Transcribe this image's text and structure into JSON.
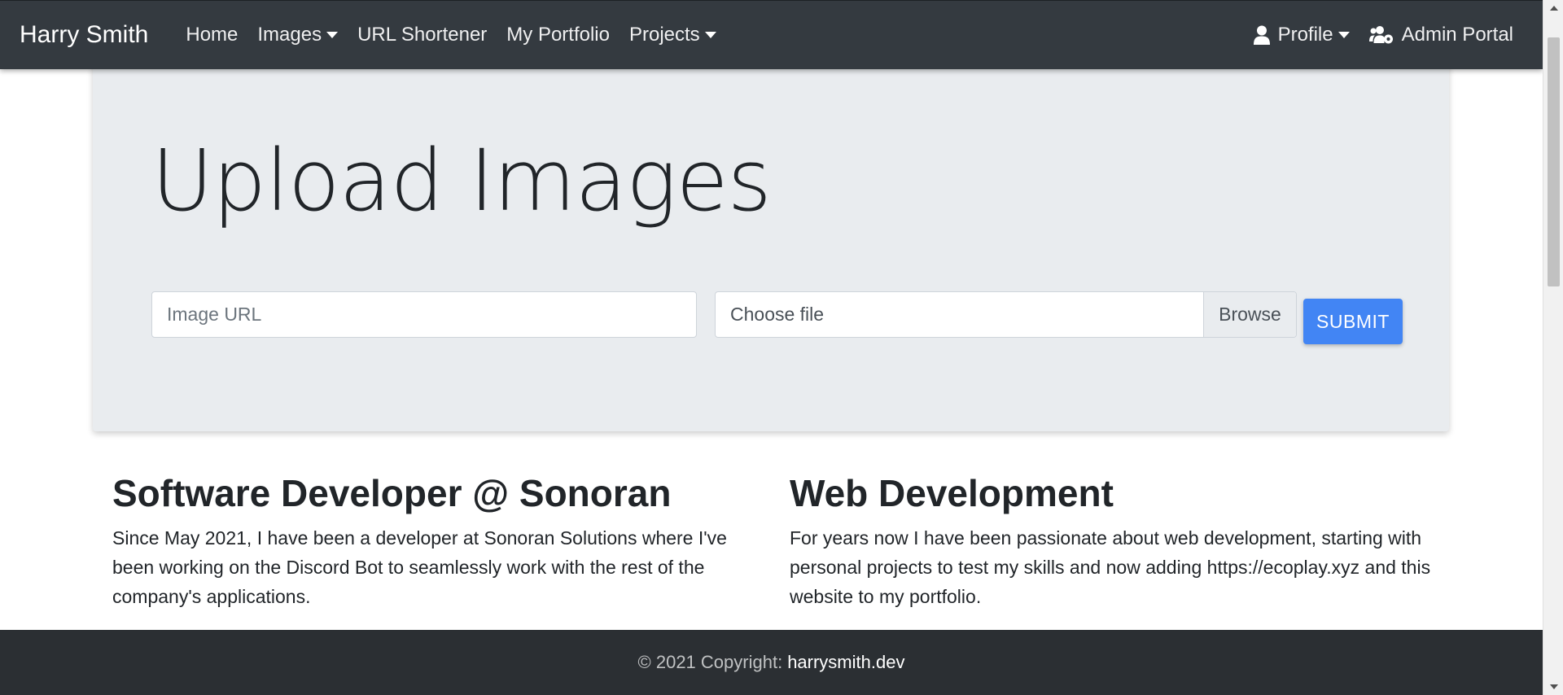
{
  "navbar": {
    "brand": "Harry Smith",
    "left_items": [
      {
        "label": "Home",
        "dropdown": false
      },
      {
        "label": "Images",
        "dropdown": true
      },
      {
        "label": "URL Shortener",
        "dropdown": false
      },
      {
        "label": "My Portfolio",
        "dropdown": false
      },
      {
        "label": "Projects",
        "dropdown": true
      }
    ],
    "profile": {
      "label": "Profile",
      "icon": "user-icon"
    },
    "admin": {
      "label": "Admin Portal",
      "icon": "users-cog-icon"
    }
  },
  "upload": {
    "title": "Upload Images",
    "url_placeholder": "Image URL",
    "file_label": "Choose file",
    "browse_label": "Browse",
    "submit_label": "SUBMIT"
  },
  "features": [
    {
      "heading": "Software Developer @ Sonoran",
      "text": "Since May 2021, I have been a developer at Sonoran Solutions where I've been working on the Discord Bot to seamlessly work with the rest of the company's applications."
    },
    {
      "heading": "Web Development",
      "text": "For years now I have been passionate about web development, starting with personal projects to test my skills and now adding https://ecoplay.xyz and this website to my portfolio."
    }
  ],
  "footer": {
    "copyright": "© 2021 Copyright:",
    "link": "harrysmith.dev"
  },
  "colors": {
    "navbar_bg": "#343a40",
    "jumbotron_bg": "#e9ecef",
    "submit_bg": "#4285f4",
    "footer_bg": "#2b2f33"
  }
}
